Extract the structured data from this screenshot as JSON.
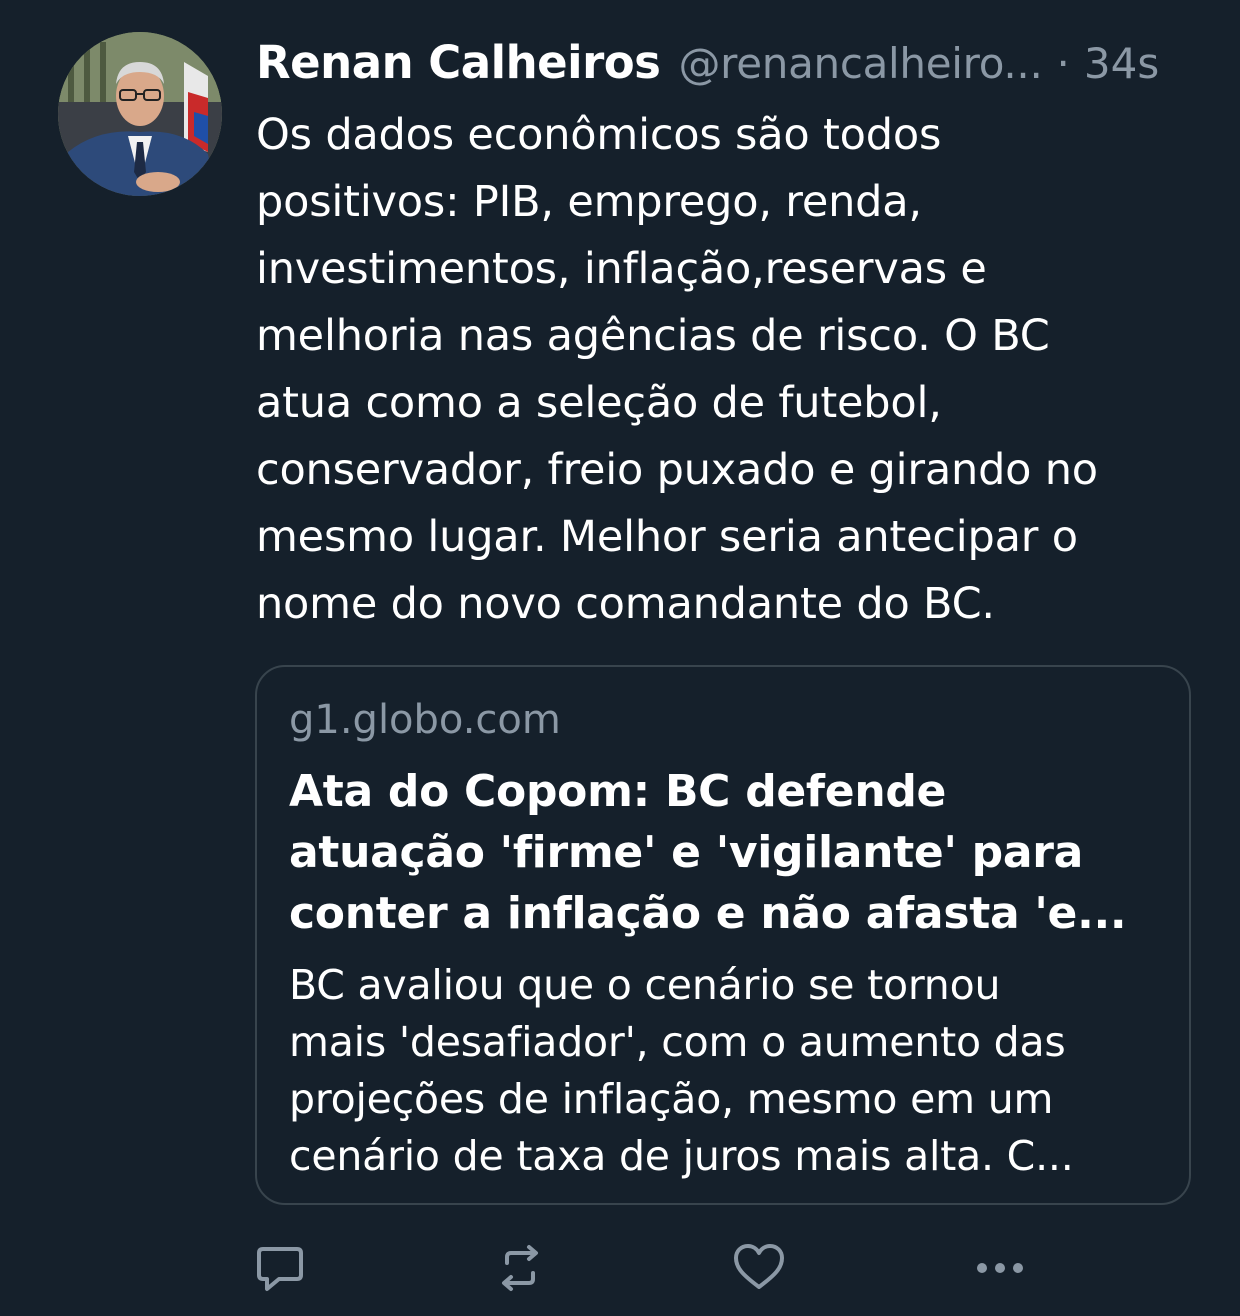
{
  "tweet": {
    "author_name": "Renan Calheiros",
    "handle": "@renancalheiro...",
    "separator": "·",
    "time": "34s",
    "text_lines": [
      "Os dados econômicos são todos",
      "positivos: PIB, emprego, renda,",
      "investimentos, inflação,reservas e",
      "melhoria nas agências de risco. O BC",
      "atua como a seleção de futebol,",
      "conservador, freio puxado e girando no",
      "mesmo lugar. Melhor seria antecipar o",
      "nome do novo comandante do BC."
    ]
  },
  "link_card": {
    "domain": "g1.globo.com",
    "title_lines": [
      "Ata do Copom: BC defende",
      "atuação 'firme' e 'vigilante' para",
      "conter a inflação e não afasta 'e..."
    ],
    "description_lines": [
      "BC avaliou que o cenário se tornou",
      "mais 'desafiador', com o aumento das",
      "projeções de inflação, mesmo em um",
      "cenário de taxa de juros mais alta. C..."
    ]
  },
  "actions": [
    {
      "icon": "reply-icon"
    },
    {
      "icon": "retweet-icon"
    },
    {
      "icon": "like-icon"
    },
    {
      "icon": "more-icon"
    }
  ],
  "colors": {
    "background": "#15202b",
    "text_primary": "#ffffff",
    "text_secondary": "#8b98a5",
    "border": "#38444d"
  }
}
